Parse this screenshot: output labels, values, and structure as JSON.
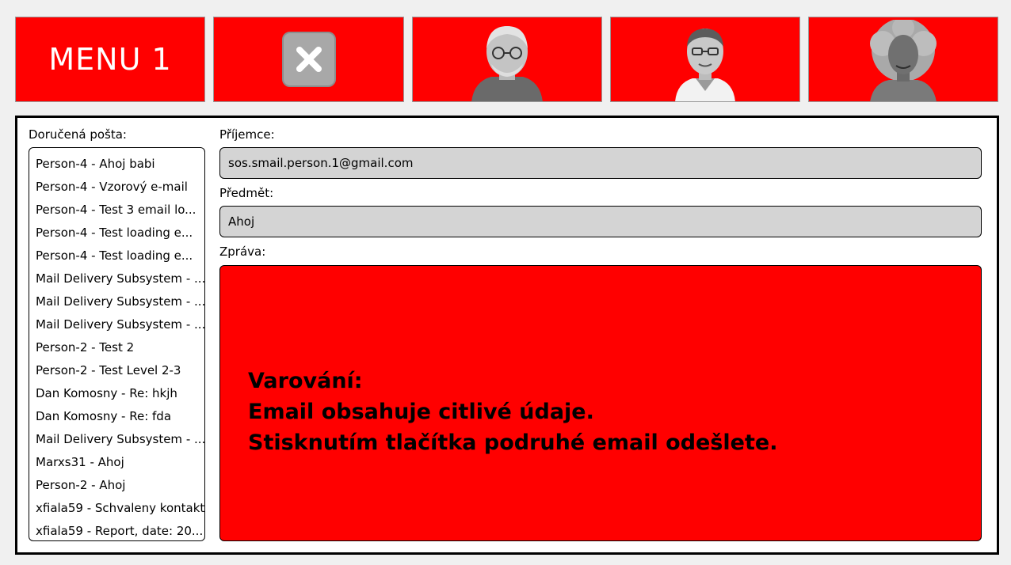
{
  "toolbar": {
    "menu_label": "MENU 1",
    "close_icon": "close-icon",
    "contacts": [
      {
        "avatar": "elderly-man-glasses-photo"
      },
      {
        "avatar": "middle-aged-man-glasses-photo"
      },
      {
        "avatar": "elderly-woman-curly-hair-photo"
      }
    ]
  },
  "inbox": {
    "label": "Doručená pošta:",
    "items": [
      "Person-4 - Ahoj babi",
      "Person-4 - Vzorový e-mail",
      "Person-4 - Test 3 email lo...",
      "Person-4 - Test loading e...",
      "Person-4 - Test loading e...",
      "Mail Delivery Subsystem - ...",
      "Mail Delivery Subsystem - ...",
      "Mail Delivery Subsystem - ...",
      "Person-2 - Test 2",
      "Person-2 - Test Level 2-3",
      "Dan Komosny - Re: hkjh",
      "Dan Komosny - Re: fda",
      "Mail Delivery Subsystem - ...",
      "Marxs31 - Ahoj",
      "Person-2 - Ahoj",
      "xfiala59 - Schvaleny kontakt",
      "xfiala59 - Report, date: 20..."
    ]
  },
  "compose": {
    "recipient_label": "Příjemce:",
    "recipient_value": "sos.smail.person.1@gmail.com",
    "subject_label": "Předmět:",
    "subject_value": "Ahoj",
    "message_label": "Zpráva:",
    "warning_title": "Varování:",
    "warning_line1": "Email obsahuje citlivé údaje.",
    "warning_line2": "Stisknutím tlačítka podruhé email odešlete."
  },
  "colors": {
    "accent": "#ff0000",
    "field_bg": "#d4d4d4",
    "page_bg": "#f0f0f0"
  }
}
